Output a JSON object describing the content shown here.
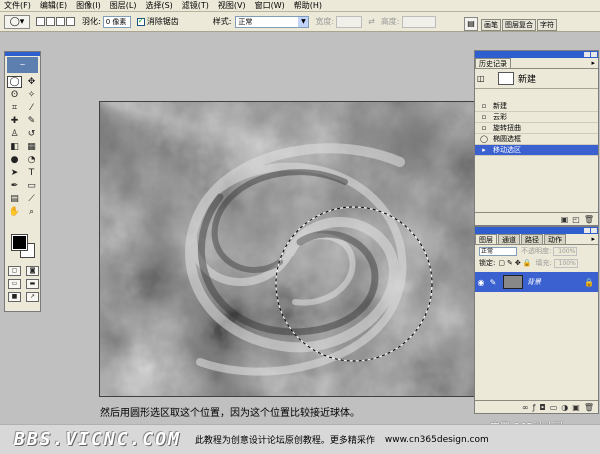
{
  "menu": [
    "文件(F)",
    "编辑(E)",
    "图像(I)",
    "图层(L)",
    "选择(S)",
    "滤镜(T)",
    "视图(V)",
    "窗口(W)",
    "帮助(H)"
  ],
  "options": {
    "feather_label": "羽化:",
    "feather_value": "0 像素",
    "antialias_label": "消除锯齿",
    "style_label": "样式:",
    "style_value": "正常",
    "width_label": "宽度:",
    "height_label": "高度:"
  },
  "palette_well": {
    "tabs": [
      "画笔",
      "图层复合",
      "字符"
    ]
  },
  "history": {
    "tab": "历史记录",
    "snapshot_label": "新建",
    "steps": [
      "新建",
      "云彩",
      "旋转扭曲",
      "椭圆选框",
      "移动选区"
    ],
    "active_index": 4
  },
  "layers": {
    "tabs": [
      "图层",
      "通道",
      "路径",
      "动作"
    ],
    "blend_mode": "正常",
    "opacity_label": "不透明度:",
    "opacity_value": "100%",
    "lock_label": "锁定:",
    "fill_label": "填充:",
    "fill_value": "100%",
    "layer_name": "背景"
  },
  "caption": "然后用圆形选区取这个位置，因为这个位置比较接近球体。",
  "watermark_right": "中国-365设计网",
  "footer": {
    "logo": "BBS.VICNC.COM",
    "text": "此教程为创意设计论坛原创教程。更多精采作",
    "url": "www.cn365design.com"
  }
}
